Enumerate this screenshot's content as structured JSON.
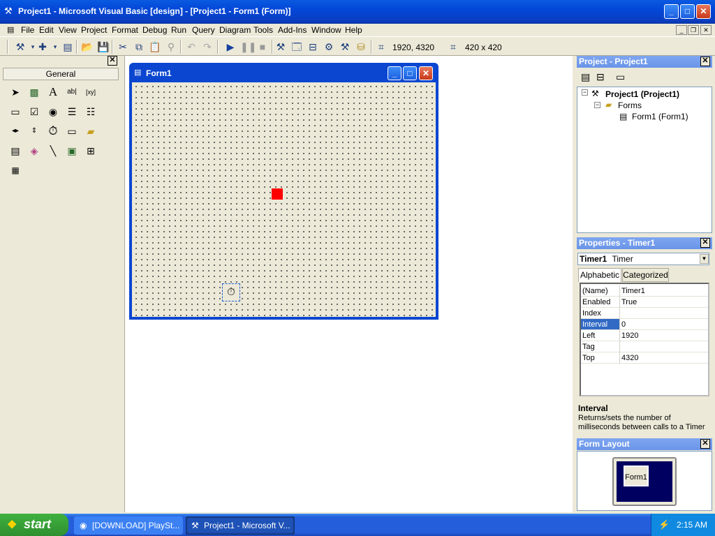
{
  "app": {
    "title": "Project1 - Microsoft Visual Basic [design] - [Project1 - Form1 (Form)]"
  },
  "menu": [
    "File",
    "Edit",
    "View",
    "Project",
    "Format",
    "Debug",
    "Run",
    "Query",
    "Diagram",
    "Tools",
    "Add-Ins",
    "Window",
    "Help"
  ],
  "toolbar": {
    "position": "1920, 4320",
    "size": "420 x 420"
  },
  "toolbox": {
    "tab": "General"
  },
  "form": {
    "title": "Form1"
  },
  "project": {
    "header": "Project - Project1",
    "tree": {
      "root": "Project1 (Project1)",
      "folder": "Forms",
      "item": "Form1 (Form1)"
    }
  },
  "properties": {
    "header": "Properties - Timer1",
    "object_name": "Timer1",
    "object_type": "Timer",
    "tabs": [
      "Alphabetic",
      "Categorized"
    ],
    "rows": [
      {
        "name": "(Name)",
        "value": "Timer1"
      },
      {
        "name": "Enabled",
        "value": "True"
      },
      {
        "name": "Index",
        "value": ""
      },
      {
        "name": "Interval",
        "value": "0"
      },
      {
        "name": "Left",
        "value": "1920"
      },
      {
        "name": "Tag",
        "value": ""
      },
      {
        "name": "Top",
        "value": "4320"
      }
    ],
    "description_title": "Interval",
    "description_text": "Returns/sets the number of milliseconds between calls to a Timer"
  },
  "form_layout": {
    "header": "Form Layout",
    "preview_label": "Form1"
  },
  "taskbar": {
    "start": "start",
    "tasks": [
      "[DOWNLOAD] PlaySt...",
      "Project1 - Microsoft V..."
    ],
    "clock": "2:15 AM"
  },
  "colors": {
    "accent": "#0a46d0",
    "selected_row": "#316ac5",
    "shape": "#ff0000"
  }
}
